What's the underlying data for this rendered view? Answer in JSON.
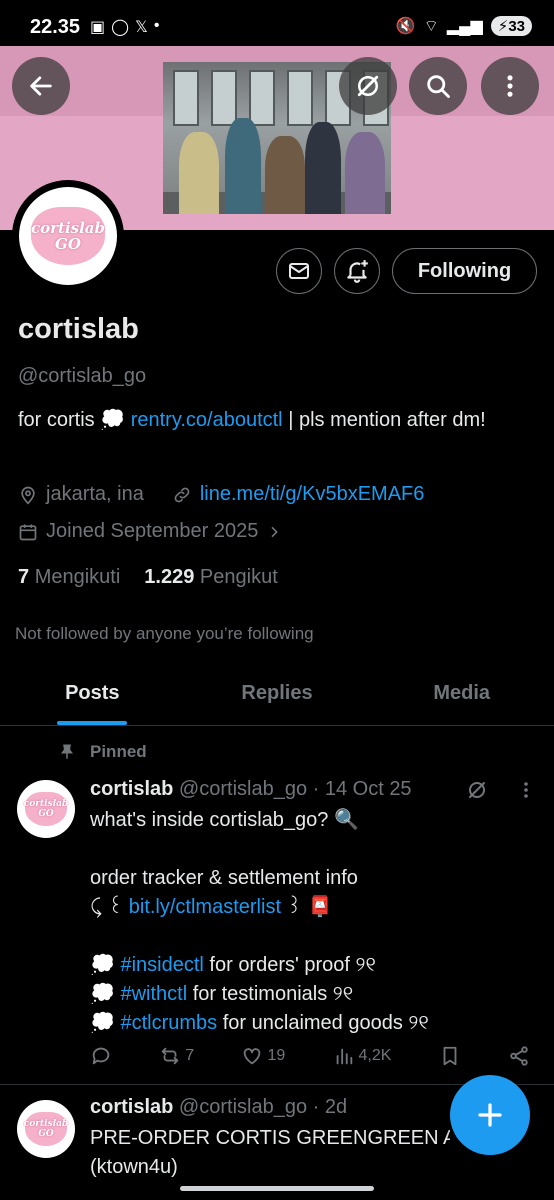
{
  "status_bar": {
    "time": "22.35",
    "left_icons": [
      "screenshot-icon",
      "whatsapp-icon",
      "x-icon",
      "dot"
    ],
    "battery": "33"
  },
  "banner": {
    "background_color": "#e4a6c5"
  },
  "profile": {
    "avatar_text_line1": "cortislab",
    "avatar_text_line2": "GO",
    "name": "cortislab",
    "handle": "@cortislab_go",
    "bio_prefix": "for cortis 💭 ",
    "bio_link": "rentry.co/aboutctl",
    "bio_suffix": " | pls mention after dm!",
    "location": "jakarta, ina",
    "website": "line.me/ti/g/Kv5bxEMAF6",
    "joined": "Joined September 2025",
    "following_count": "7",
    "following_label": "Mengikuti",
    "followers_count": "1.229",
    "followers_label": "Pengikut",
    "not_followed": "Not followed by anyone you’re following"
  },
  "buttons": {
    "following": "Following"
  },
  "tabs": [
    {
      "label": "Posts",
      "active": true
    },
    {
      "label": "Replies",
      "active": false
    },
    {
      "label": "Media",
      "active": false
    }
  ],
  "tweets": [
    {
      "pinned_label": "Pinned",
      "name": "cortislab",
      "meta": "@cortislab_go · 14 Oct 25",
      "line1": "what's inside cortislab_go? 🔍",
      "line2": "order tracker & settlement info",
      "line3_prefix": "⤹ ꒰ ",
      "line3_link": "bit.ly/ctlmasterlist",
      "line3_suffix": " ꒱ 📮",
      "tag1": "#insidectl",
      "tag1_text": " for orders' proof ୨୧",
      "tag2": "#withctl",
      "tag2_text": " for testimonials  ୨୧",
      "tag3": "#ctlcrumbs",
      "tag3_text": " for unclaimed goods ୨୧",
      "bullet": "💭 ",
      "retweets": "7",
      "likes": "19",
      "views": "4,2K"
    },
    {
      "name": "cortislab",
      "meta": "@cortislab_go · 2d",
      "line1": "PRE-ORDER CORTIS GREENGREEN AL",
      "line2": "(ktown4u)"
    }
  ],
  "colors": {
    "accent": "#1d9bf0",
    "muted": "#71767b",
    "pink": "#f4b1c9"
  }
}
